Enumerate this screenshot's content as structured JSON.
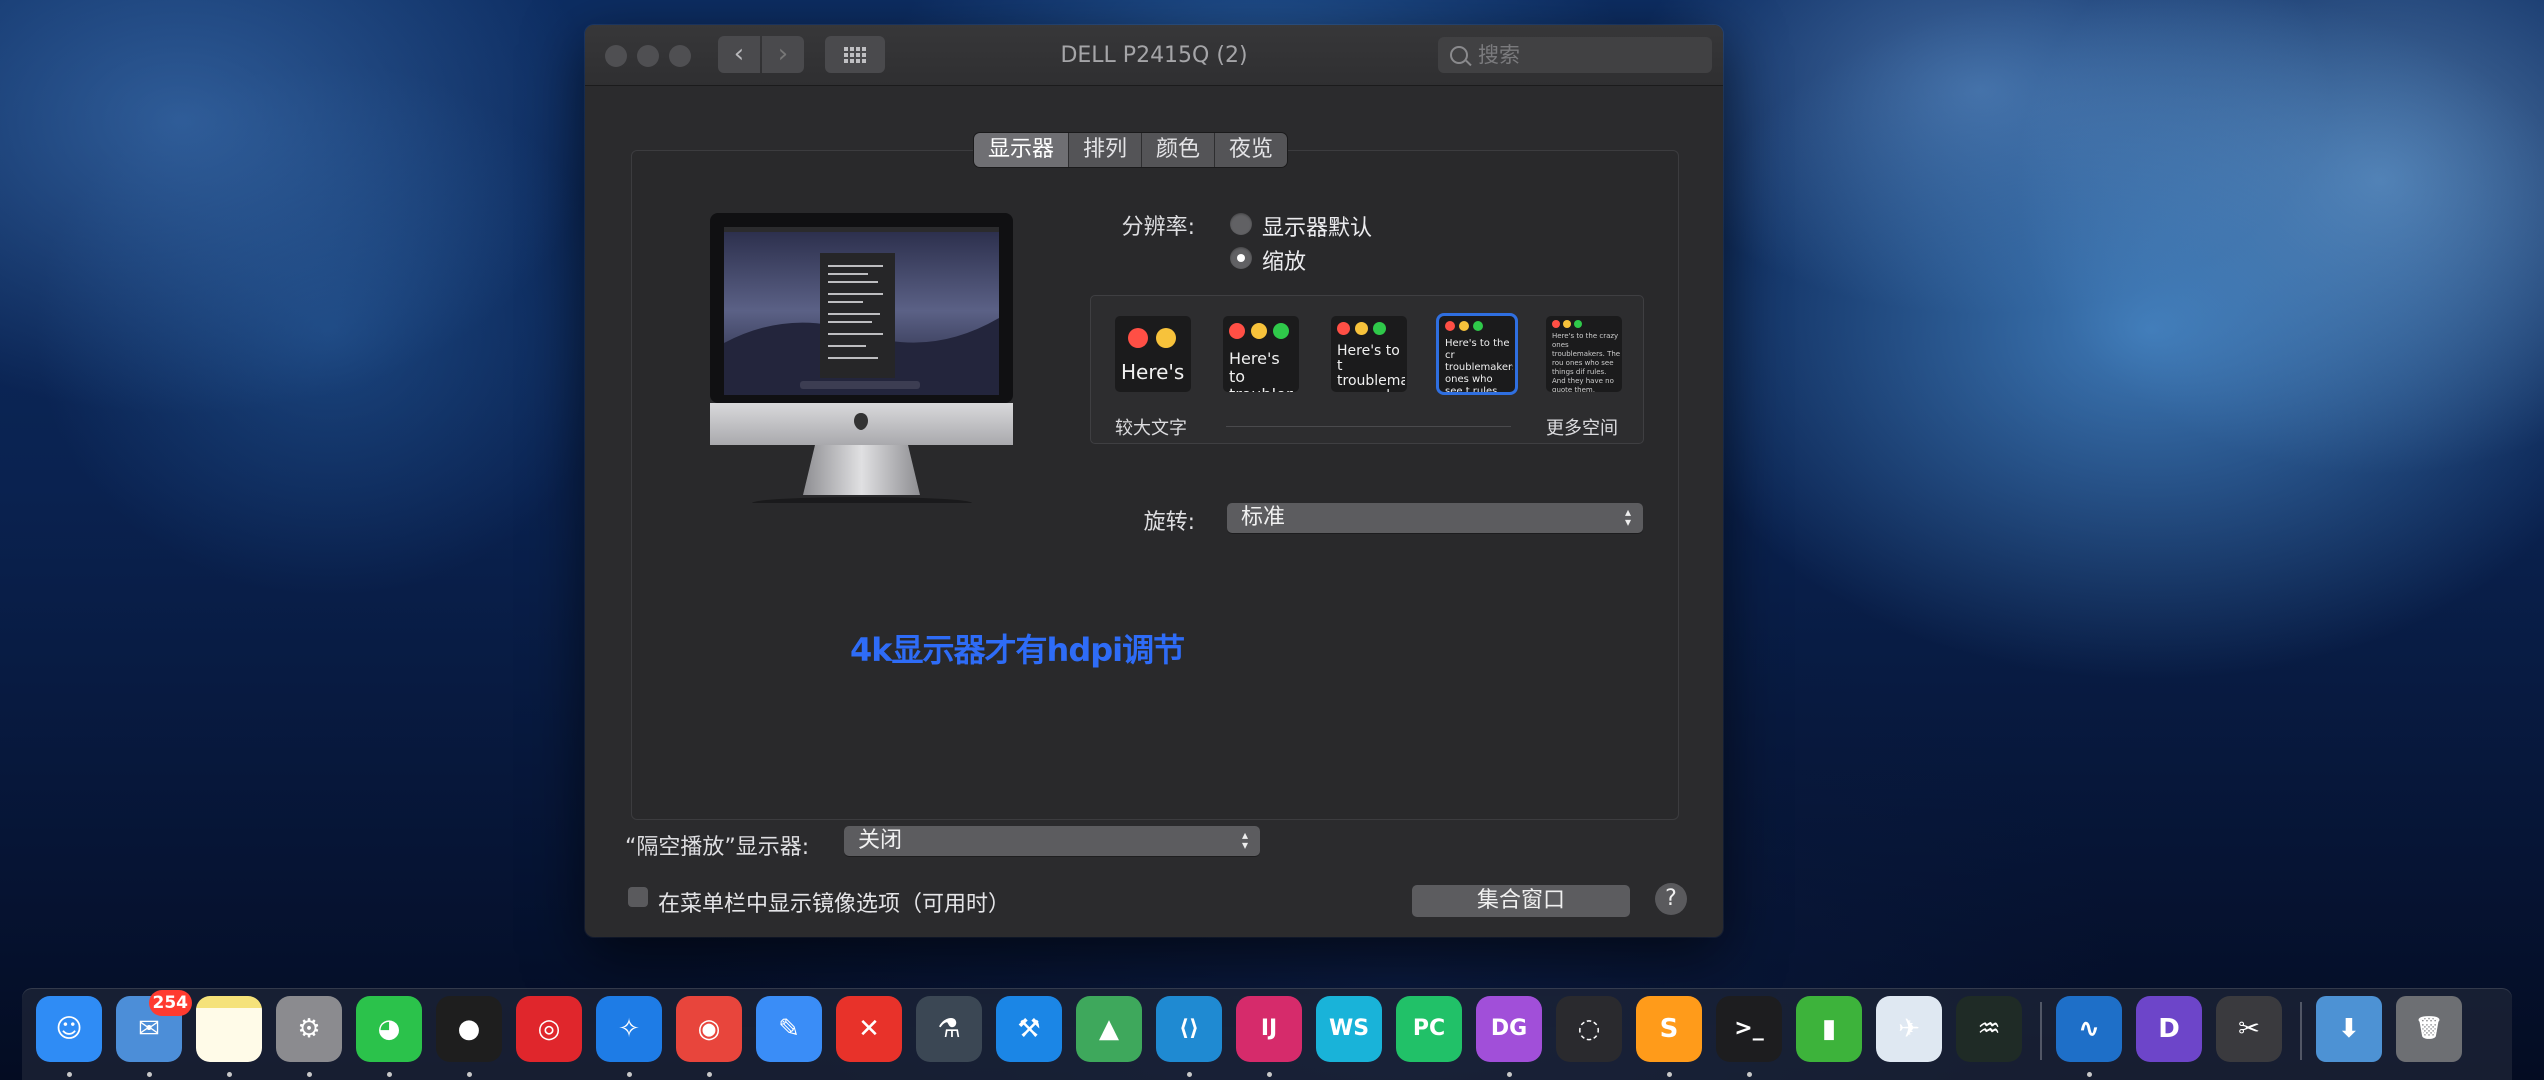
{
  "window": {
    "title": "DELL P2415Q (2)",
    "search_placeholder": "搜索"
  },
  "tabs": [
    {
      "label": "显示器",
      "active": true
    },
    {
      "label": "排列",
      "active": false
    },
    {
      "label": "颜色",
      "active": false
    },
    {
      "label": "夜览",
      "active": false
    }
  ],
  "resolution": {
    "label": "分辨率:",
    "options": [
      {
        "label": "显示器默认",
        "selected": false
      },
      {
        "label": "缩放",
        "selected": true
      }
    ],
    "scale_thumbs": [
      {
        "text": "Here's",
        "selected": false
      },
      {
        "text": "Here's to troublem",
        "selected": false
      },
      {
        "text": "Here's to t troublema ones who",
        "selected": false
      },
      {
        "text": "Here's to the cr troublemakers. ones who see t rules. And they",
        "selected": true
      },
      {
        "text": "Here's to the crazy ones troublemakers. The rou ones who see things dif rules. And they have no quote them, disagree them. About the only th Because they change th",
        "selected": false
      }
    ],
    "left_caption": "较大文字",
    "right_caption": "更多空间"
  },
  "rotation": {
    "label": "旋转:",
    "value": "标准"
  },
  "annotation": "4k显示器才有hdpi调节",
  "airplay": {
    "label": "“隔空播放”显示器:",
    "value": "关闭"
  },
  "mirror_option": {
    "label": "在菜单栏中显示镜像选项（可用时）",
    "checked": false
  },
  "gather_button": "集合窗口",
  "help_symbol": "?",
  "dock": {
    "mail_badge": "254",
    "apps": [
      {
        "name": "finder",
        "glyph": "☺",
        "color": "#2f8cf5",
        "running": true
      },
      {
        "name": "mail",
        "glyph": "✉",
        "color": "#4c8ed8",
        "running": true
      },
      {
        "name": "notes",
        "glyph": "",
        "color": "#f5e27a",
        "running": true
      },
      {
        "name": "system-preferences",
        "glyph": "⚙",
        "color": "#8b8b8f",
        "running": true
      },
      {
        "name": "wechat",
        "glyph": "◕",
        "color": "#2bc24b",
        "running": true
      },
      {
        "name": "qq",
        "glyph": "●",
        "color": "#1e1e1e",
        "running": true
      },
      {
        "name": "netease-music",
        "glyph": "◎",
        "color": "#e0262c",
        "running": false
      },
      {
        "name": "safari",
        "glyph": "✧",
        "color": "#1e7ce6",
        "running": true
      },
      {
        "name": "chrome",
        "glyph": "◉",
        "color": "#e8453c",
        "running": true
      },
      {
        "name": "lark",
        "glyph": "✎",
        "color": "#3a8df7",
        "running": false
      },
      {
        "name": "xmind",
        "glyph": "✕",
        "color": "#e8322a",
        "running": false
      },
      {
        "name": "instruments",
        "glyph": "⚗",
        "color": "#3b4754",
        "running": false
      },
      {
        "name": "xcode",
        "glyph": "⚒",
        "color": "#1b86e6",
        "running": false
      },
      {
        "name": "android-studio",
        "glyph": "▲",
        "color": "#3ea85c",
        "running": false
      },
      {
        "name": "vscode",
        "glyph": "⟨⟩",
        "color": "#1f8ad2",
        "running": true
      },
      {
        "name": "intellij",
        "glyph": "IJ",
        "color": "#d62b6b",
        "running": true
      },
      {
        "name": "webstorm",
        "glyph": "WS",
        "color": "#19b3d9",
        "running": false
      },
      {
        "name": "pycharm",
        "glyph": "PC",
        "color": "#21c168",
        "running": false
      },
      {
        "name": "datagrip",
        "glyph": "DG",
        "color": "#a14fd9",
        "running": true
      },
      {
        "name": "navicat",
        "glyph": "◌",
        "color": "#2a2a2e",
        "running": false
      },
      {
        "name": "sublime",
        "glyph": "S",
        "color": "#ff9b1a",
        "running": true
      },
      {
        "name": "terminal",
        "glyph": ">_",
        "color": "#1d1d1f",
        "running": true
      },
      {
        "name": "pipe",
        "glyph": "▮",
        "color": "#3db33b",
        "running": false
      },
      {
        "name": "telegram-bird",
        "glyph": "✈",
        "color": "#dfe8f2",
        "running": false
      },
      {
        "name": "activity-monitor",
        "glyph": "♒",
        "color": "#1f2b26",
        "running": false
      },
      {
        "name": "intel-power-gadget",
        "glyph": "∿",
        "color": "#1e6fc8",
        "running": true
      },
      {
        "name": "dash",
        "glyph": "D",
        "color": "#6d45c9",
        "running": false
      },
      {
        "name": "screenshot-tool",
        "glyph": "✂",
        "color": "#3a3a3e",
        "running": false
      },
      {
        "name": "downloads-folder",
        "glyph": "⬇",
        "color": "#4d92d4",
        "running": false
      },
      {
        "name": "trash",
        "glyph": "🗑",
        "color": "#6d6f73",
        "running": false
      }
    ]
  }
}
